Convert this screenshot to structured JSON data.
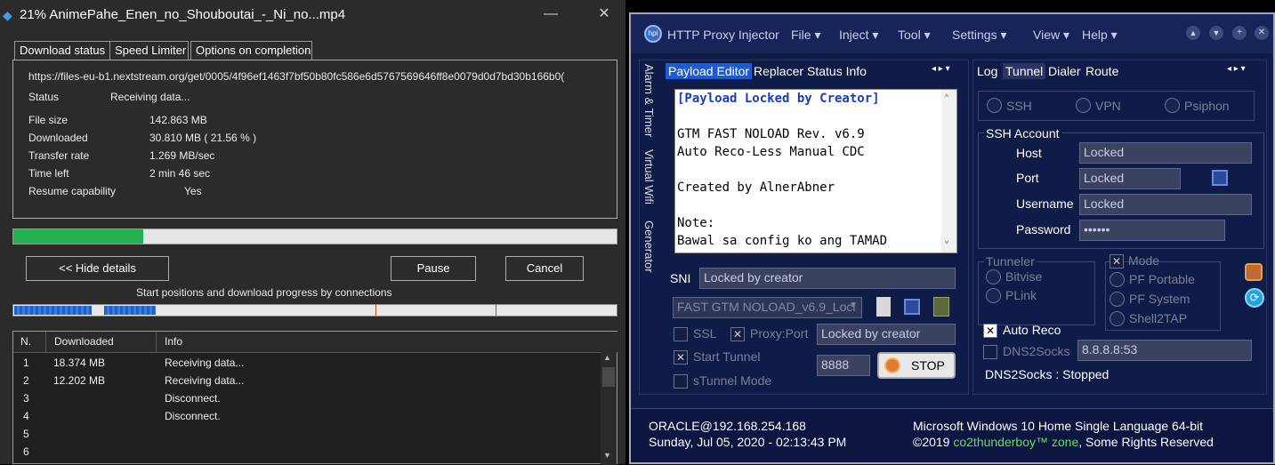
{
  "idm": {
    "title": "21% AnimePahe_Enen_no_Shouboutai_-_Ni_no...mp4",
    "tabs": [
      "Download status",
      "Speed Limiter",
      "Options on completion"
    ],
    "url": "https://files-eu-b1.nextstream.org/get/0005/4f96ef1463f7bf50b80fc586e6d5767569646ff8e0079d0d7bd30b166b0(",
    "status_label": "Status",
    "status_value": "Receiving data...",
    "file_size_label": "File size",
    "file_size_value": "142.863  MB",
    "downloaded_label": "Downloaded",
    "downloaded_value": "30.810  MB  ( 21.56 % )",
    "transfer_label": "Transfer rate",
    "transfer_value": "1.269  MB/sec",
    "time_left_label": "Time left",
    "time_left_value": "2 min 46 sec",
    "resume_label": "Resume capability",
    "resume_value": "Yes",
    "progress_fraction": 0.2156,
    "hide_details": "<< Hide details",
    "pause": "Pause",
    "cancel": "Cancel",
    "connections_caption": "Start positions and download progress by connections",
    "table_headers": [
      "N.",
      "Downloaded",
      "Info"
    ],
    "rows": [
      {
        "n": "1",
        "downloaded": "18.374  MB",
        "info": "Receiving data..."
      },
      {
        "n": "2",
        "downloaded": "12.202  MB",
        "info": "Receiving data..."
      },
      {
        "n": "3",
        "downloaded": "",
        "info": "Disconnect."
      },
      {
        "n": "4",
        "downloaded": "",
        "info": "Disconnect."
      },
      {
        "n": "5",
        "downloaded": "",
        "info": ""
      },
      {
        "n": "6",
        "downloaded": "",
        "info": ""
      }
    ]
  },
  "hpi": {
    "title": "HTTP Proxy Injector",
    "menu": [
      "File",
      "Inject",
      "Tool",
      "Settings",
      "View",
      "Help"
    ],
    "vertical_tabs": [
      "Alarm & Timer",
      "Virtual Wifi",
      "Generator"
    ],
    "left_tabs": [
      "Payload Editor",
      "Replacer",
      "Status Info"
    ],
    "payload_lines": [
      "[Payload Locked by Creator]",
      "",
      "GTM FAST NOLOAD Rev. v6.9",
      "Auto Reco-Less Manual CDC",
      "",
      "Created by AlnerAbner",
      "",
      "Note:",
      "Bawal sa config ko ang TAMAD"
    ],
    "sni_label": "SNI",
    "sni_value": "Locked by creator",
    "config_select": "FAST GTM NOLOAD_v6.9_Locl",
    "ssl_label": "SSL",
    "proxy_port_label": "Proxy:Port",
    "proxy_value": "Locked by creator",
    "start_tunnel_label": "Start Tunnel",
    "port_value": "8888",
    "stop_label": "STOP",
    "stunnel_label": "sTunnel Mode",
    "right_tabs": [
      "Log",
      "Tunnel",
      "Dialer",
      "Route"
    ],
    "modes": [
      "SSH",
      "VPN",
      "Psiphon"
    ],
    "ssh_account_label": "SSH Account",
    "host_label": "Host",
    "host_value": "Locked",
    "port_label": "Port",
    "port_field_value": "Locked",
    "username_label": "Username",
    "username_value": "Locked",
    "password_label": "Password",
    "password_value": "••••••",
    "tunneler_label": "Tunneler",
    "tunnelers": [
      "Bitvise",
      "PLink"
    ],
    "mode_label": "Mode",
    "mode_options": [
      "PF Portable",
      "PF System",
      "Shell2TAP"
    ],
    "auto_reco_label": "Auto Reco",
    "dns2socks_label": "DNS2Socks",
    "dns_value": "8.8.8.8:53",
    "dns_status": "DNS2Socks : Stopped",
    "footer_left_1": "ORACLE@192.168.254.168",
    "footer_left_2": "Sunday, Jul 05, 2020 - 02:13:43 PM",
    "footer_right_1": "Microsoft Windows 10 Home Single Language 64-bit",
    "footer_right_2a": "©2019 ",
    "footer_right_2b": "co2thunderboy™ zone",
    "footer_right_2c": ", Some Rights Reserved"
  }
}
